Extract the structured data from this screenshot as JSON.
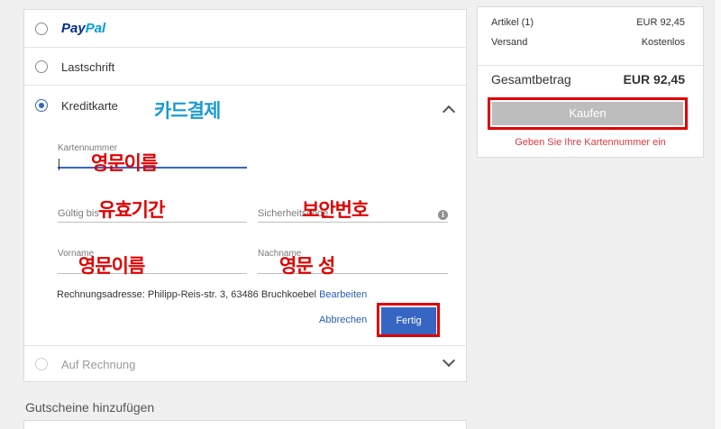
{
  "payment_methods": {
    "paypal": {
      "logo_part1": "Pay",
      "logo_part2": "Pal"
    },
    "lastschrift": {
      "label": "Lastschrift"
    },
    "kreditkarte": {
      "label": "Kreditkarte",
      "selected": true
    },
    "auf_rechnung": {
      "label": "Auf Rechnung",
      "disabled": true
    }
  },
  "card_form": {
    "card_number": {
      "label": "Kartennummer",
      "value": ""
    },
    "expiry": {
      "label": "Gültig bis"
    },
    "security_code": {
      "label": "Sicherheitscode"
    },
    "first_name": {
      "label": "Vorname"
    },
    "last_name": {
      "label": "Nachname"
    },
    "billing_prefix": "Rechnungsadresse: Philipp-Reis-str. 3, 63486 Bruchkoebel",
    "billing_edit": "Bearbeiten",
    "cancel_label": "Abbrechen",
    "done_label": "Fertig"
  },
  "annotations": {
    "card_payment": "카드결제",
    "card_number": "영문이름",
    "expiry": "유효기간",
    "security_code": "보안번호",
    "first_name": "영문이름",
    "last_name": "영문 성"
  },
  "coupons": {
    "label": "Gutscheine hinzufügen"
  },
  "summary": {
    "items_label": "Artikel (1)",
    "items_value": "EUR 92,45",
    "shipping_label": "Versand",
    "shipping_value": "Kostenlos",
    "total_label": "Gesamtbetrag",
    "total_value": "EUR 92,45",
    "buy_label": "Kaufen",
    "error": "Geben Sie Ihre Kartennummer ein"
  },
  "colors": {
    "accent": "#3665c3",
    "annotation_red": "#e00000",
    "annotation_cyan": "#1a9bd7",
    "error": "#e0383e"
  }
}
